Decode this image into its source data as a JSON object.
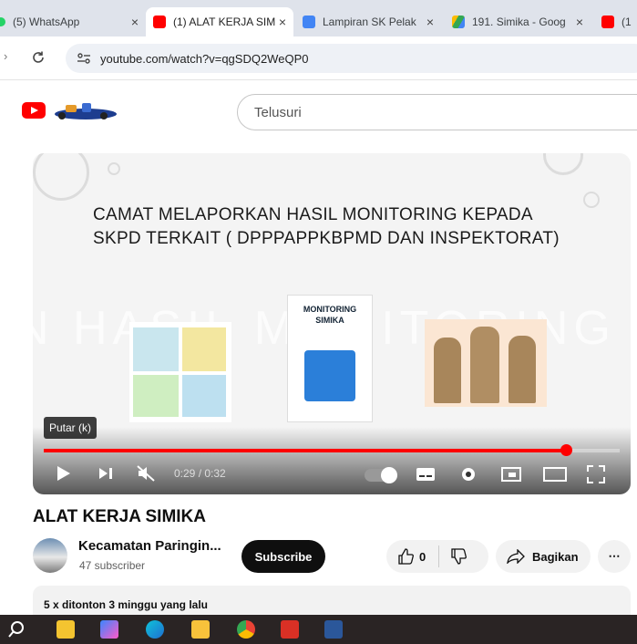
{
  "browser": {
    "tabs": [
      {
        "label": "(5) WhatsApp",
        "close": "×"
      },
      {
        "label": "(1) ALAT KERJA SIM",
        "close": "×"
      },
      {
        "label": "Lampiran SK Pelak",
        "close": "×"
      },
      {
        "label": "191. Simika - Goog",
        "close": "×"
      },
      {
        "label": "(1",
        "close": ""
      }
    ],
    "url": "youtube.com/watch?v=qgSDQ2WeQP0"
  },
  "youtube": {
    "search_placeholder": "Telusuri"
  },
  "player": {
    "slide_title_line1": "CAMAT MELAPORKAN HASIL MONITORING KEPADA",
    "slide_title_line2": "SKPD TERKAIT ( DPPPAPPKBPMD DAN INSPEKTORAT)",
    "watermark": "N HASIL MONITORING K",
    "poster_line1": "MONITORING",
    "poster_line2": "SIMIKA",
    "tooltip": "Putar (k)",
    "time": "0:29 / 0:32",
    "progress_fraction": 0.906
  },
  "video": {
    "title": "ALAT KERJA SIMIKA",
    "channel": "Kecamatan Paringin...",
    "subscribers": "47 subscriber",
    "subscribe_label": "Subscribe",
    "like_count": "0",
    "share_label": "Bagikan",
    "more_label": "⋯",
    "description": "5 x ditonton  3 minggu yang lalu"
  },
  "colors": {
    "accent": "#ff0000",
    "tab_bg": "#dfe3eb"
  }
}
